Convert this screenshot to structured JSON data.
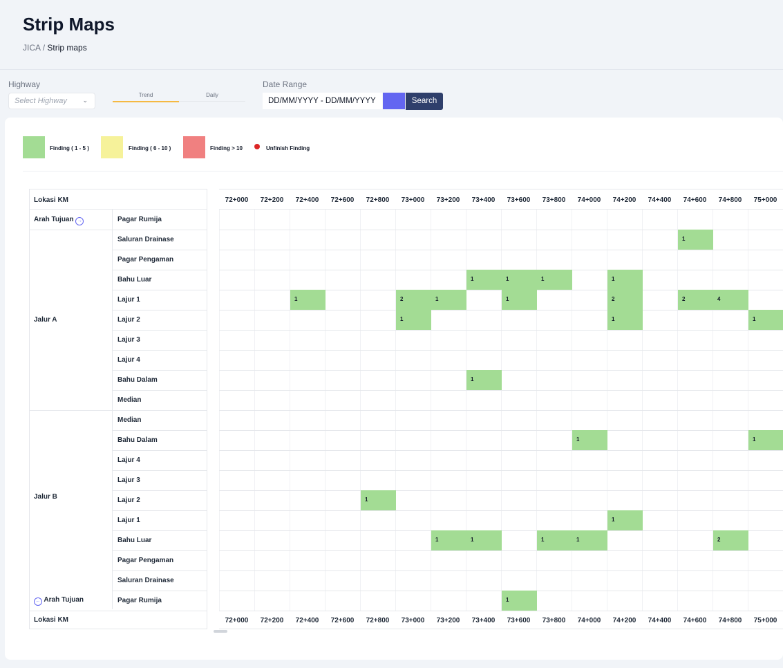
{
  "page": {
    "title": "Strip Maps",
    "breadcrumb_root": "JICA",
    "breadcrumb_current": "Strip maps"
  },
  "filters": {
    "highway_label": "Highway",
    "highway_placeholder": "Select Highway",
    "tabs": [
      {
        "label": "Trend",
        "active": true
      },
      {
        "label": "Daily",
        "active": false
      }
    ],
    "date_range_label": "Date Range",
    "date_range_value": "DD/MM/YYYY - DD/MM/YYYY",
    "search_label": "Search",
    "accent_color": "#6366f1",
    "button_color": "#2f3f6b"
  },
  "legend": [
    {
      "label": "Finding ( 1 - 5 )",
      "color": "#a3dc94",
      "shape": "box"
    },
    {
      "label": "Finding ( 6 - 10 )",
      "color": "#f6f29a",
      "shape": "box"
    },
    {
      "label": "Finding > 10",
      "color": "#f08080",
      "shape": "box"
    },
    {
      "label": "Unfinish Finding",
      "color": "#dc2626",
      "shape": "dot"
    }
  ],
  "strip_map": {
    "location_header": "Lokasi KM",
    "direction_label": "Arah Tujuan",
    "km_columns": [
      "72+000",
      "72+200",
      "72+400",
      "72+600",
      "72+800",
      "73+000",
      "73+200",
      "73+400",
      "73+600",
      "73+800",
      "74+000",
      "74+200",
      "74+400",
      "74+600",
      "74+800",
      "75+000"
    ],
    "groups": [
      {
        "name": "Jalur A"
      },
      {
        "name": "Jalur B"
      }
    ],
    "rows": [
      "Pagar Rumija",
      "Saluran Drainase",
      "Pagar Pengaman",
      "Bahu Luar",
      "Lajur 1",
      "Lajur 2",
      "Lajur 3",
      "Lajur 4",
      "Bahu Dalam",
      "Median",
      "Median",
      "Bahu Dalam",
      "Lajur 4",
      "Lajur 3",
      "Lajur 2",
      "Lajur 1",
      "Bahu Luar",
      "Pagar Pengaman",
      "Saluran Drainase",
      "Pagar Rumija"
    ],
    "findings": [
      {
        "row": 1,
        "col": 13,
        "count": "1"
      },
      {
        "row": 3,
        "col": 7,
        "count": "1"
      },
      {
        "row": 3,
        "col": 8,
        "count": "1"
      },
      {
        "row": 3,
        "col": 9,
        "count": "1"
      },
      {
        "row": 3,
        "col": 11,
        "count": "1"
      },
      {
        "row": 4,
        "col": 2,
        "count": "1"
      },
      {
        "row": 4,
        "col": 5,
        "count": "2"
      },
      {
        "row": 4,
        "col": 6,
        "count": "1"
      },
      {
        "row": 4,
        "col": 8,
        "count": "1"
      },
      {
        "row": 4,
        "col": 11,
        "count": "2"
      },
      {
        "row": 4,
        "col": 13,
        "count": "2"
      },
      {
        "row": 4,
        "col": 14,
        "count": "4"
      },
      {
        "row": 5,
        "col": 5,
        "count": "1"
      },
      {
        "row": 5,
        "col": 11,
        "count": "1"
      },
      {
        "row": 5,
        "col": 15,
        "count": "1"
      },
      {
        "row": 8,
        "col": 7,
        "count": "1"
      },
      {
        "row": 11,
        "col": 10,
        "count": "1"
      },
      {
        "row": 11,
        "col": 15,
        "count": "1"
      },
      {
        "row": 14,
        "col": 4,
        "count": "1"
      },
      {
        "row": 15,
        "col": 11,
        "count": "1"
      },
      {
        "row": 16,
        "col": 6,
        "count": "1"
      },
      {
        "row": 16,
        "col": 7,
        "count": "1"
      },
      {
        "row": 16,
        "col": 9,
        "count": "1"
      },
      {
        "row": 16,
        "col": 10,
        "count": "1"
      },
      {
        "row": 16,
        "col": 14,
        "count": "2"
      },
      {
        "row": 19,
        "col": 8,
        "count": "1"
      }
    ]
  }
}
